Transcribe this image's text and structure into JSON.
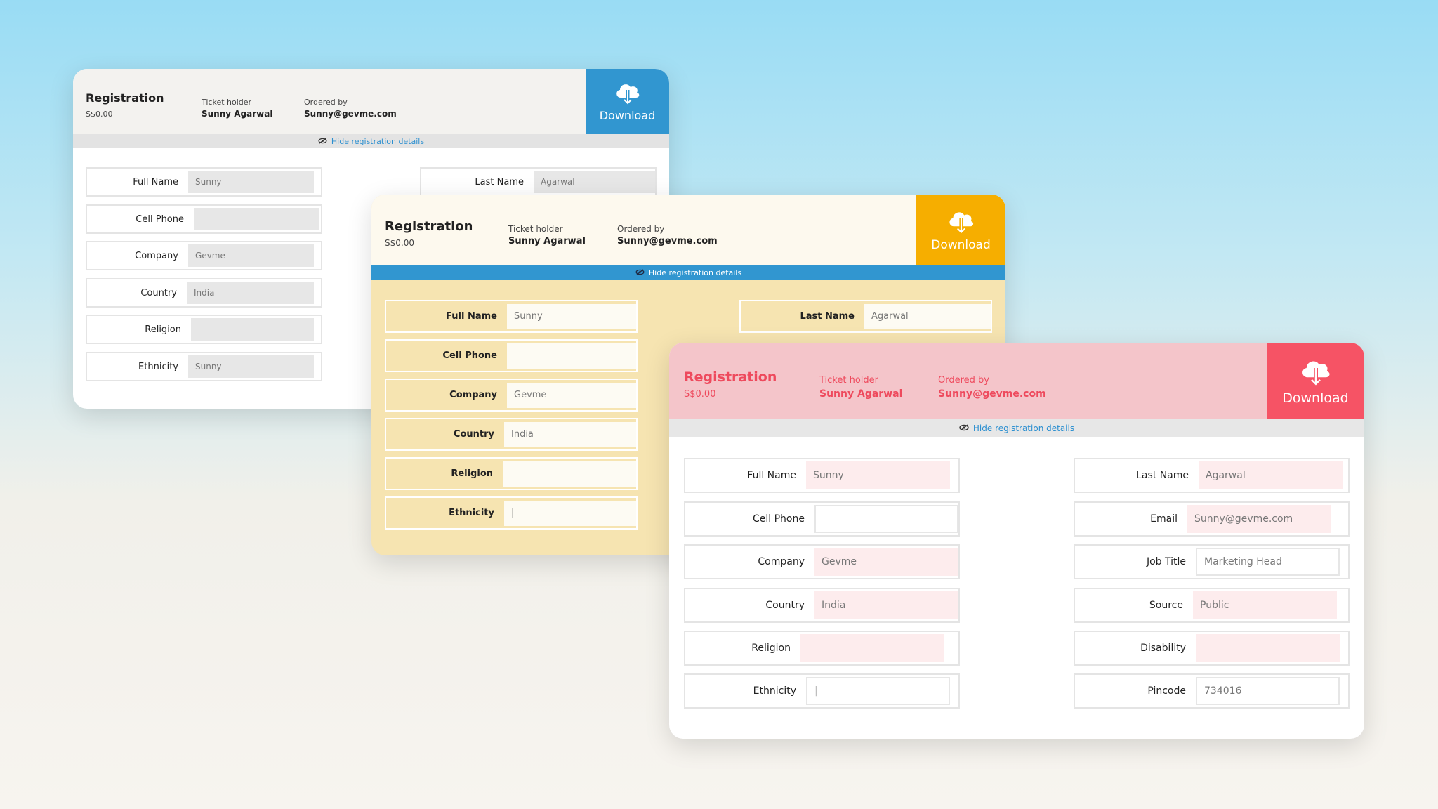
{
  "common": {
    "title": "Registration",
    "price": "S$0.00",
    "ticket_holder_label": "Ticket holder",
    "ticket_holder": "Sunny Agarwal",
    "ordered_by_label": "Ordered by",
    "ordered_by": "Sunny@gevme.com",
    "download_label": "Download",
    "hide_details_label": "Hide registration details"
  },
  "colors": {
    "card1_accent": "#3196d0",
    "card2_accent": "#f6ae00",
    "card3_accent": "#f65365",
    "link": "#2b8fd0"
  },
  "card1": {
    "fields": [
      {
        "label": "Full Name",
        "value": "Sunny"
      },
      {
        "label": "Cell Phone",
        "value": ""
      },
      {
        "label": "Company",
        "value": "Gevme"
      },
      {
        "label": "Country",
        "value": "India"
      },
      {
        "label": "Religion",
        "value": ""
      },
      {
        "label": "Ethnicity",
        "value": "Sunny"
      },
      {
        "label": "Last Name",
        "value": "Agarwal"
      }
    ]
  },
  "card2": {
    "fields": [
      {
        "label": "Full Name",
        "value": "Sunny"
      },
      {
        "label": "Cell Phone",
        "value": ""
      },
      {
        "label": "Company",
        "value": "Gevme"
      },
      {
        "label": "Country",
        "value": "India"
      },
      {
        "label": "Religion",
        "value": ""
      },
      {
        "label": "Ethnicity",
        "value": "|"
      },
      {
        "label": "Last Name",
        "value": "Agarwal"
      }
    ]
  },
  "card3": {
    "left_fields": [
      {
        "label": "Full Name",
        "value": "Sunny"
      },
      {
        "label": "Cell Phone",
        "value": ""
      },
      {
        "label": "Company",
        "value": "Gevme"
      },
      {
        "label": "Country",
        "value": "India"
      },
      {
        "label": "Religion",
        "value": ""
      },
      {
        "label": "Ethnicity",
        "value": "|"
      }
    ],
    "right_fields": [
      {
        "label": "Last Name",
        "value": "Agarwal"
      },
      {
        "label": "Email",
        "value": "Sunny@gevme.com"
      },
      {
        "label": "Job Title",
        "value": "Marketing Head"
      },
      {
        "label": "Source",
        "value": "Public"
      },
      {
        "label": "Disability",
        "value": ""
      },
      {
        "label": "Pincode",
        "value": "734016"
      }
    ]
  }
}
